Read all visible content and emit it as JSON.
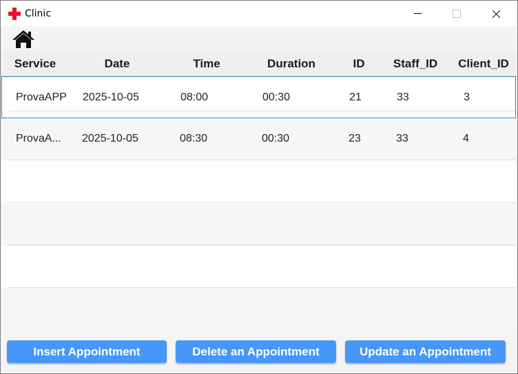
{
  "window": {
    "title": "Clinic"
  },
  "toolbar": {
    "home_icon": "home-icon"
  },
  "table": {
    "columns": [
      "Service",
      "Date",
      "Time",
      "Duration",
      "ID",
      "Staff_ID",
      "Client_ID"
    ],
    "rows": [
      {
        "service": "ProvaAPP",
        "date": "2025-10-05",
        "time": "08:00",
        "duration": "00:30",
        "id": "21",
        "staff_id": "33",
        "client_id": "3"
      },
      {
        "service": "ProvaA...",
        "date": "2025-10-05",
        "time": "08:30",
        "duration": "00:30",
        "id": "23",
        "staff_id": "33",
        "client_id": "4"
      }
    ]
  },
  "buttons": {
    "insert": "Insert Appointment",
    "delete": "Delete an Appointment",
    "update": "Update an Appointment"
  },
  "colors": {
    "accent": "#4797f9",
    "selection_border": "#2e8ac8",
    "icon_red": "#e81224"
  }
}
